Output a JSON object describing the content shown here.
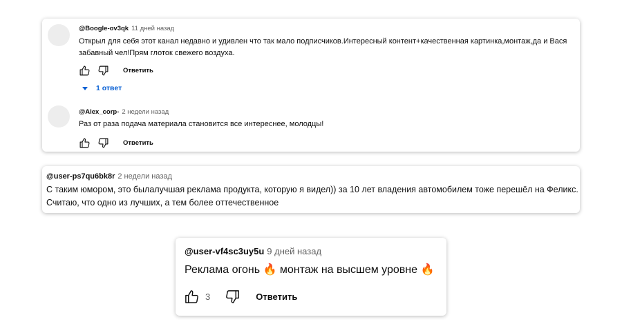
{
  "comments": [
    {
      "author": "@Boogle-ov3qk",
      "time": "11 дней назад",
      "text": "Открыл для себя этот канал недавно и удивлен что так мало подписчиков.Интересный контент+качественная картинка,монтаж,да и Вася забавный чел!Прям глоток свежего воздуха.",
      "reply_label": "Ответить",
      "replies_label": "1 ответ"
    },
    {
      "author": "@Alex_corp-",
      "time": "2 недели назад",
      "text": "Раз от раза подача материала становится все интереснее, молодцы!",
      "reply_label": "Ответить"
    },
    {
      "author": "@user-ps7qu6bk8r",
      "time": "2 недели назад",
      "text": "С таким юмором, это былалучшая реклама продукта, которую я видел)) за 10 лет владения автомобилем тоже перешёл на Феликс. Считаю, что одно из лучших, а тем более оттечественное"
    },
    {
      "author": "@user-vf4sc3uy5u",
      "time": "9 дней назад",
      "text": "Реклама огонь 🔥 монтаж на высшем уровне 🔥",
      "likes": "3",
      "reply_label": "Ответить"
    }
  ],
  "icons": {
    "like": "thumbs-up-icon",
    "dislike": "thumbs-down-icon",
    "expand": "caret-down-icon"
  },
  "colors": {
    "link": "#065fd4",
    "secondary_text": "#606060",
    "avatar": "#ededed"
  }
}
